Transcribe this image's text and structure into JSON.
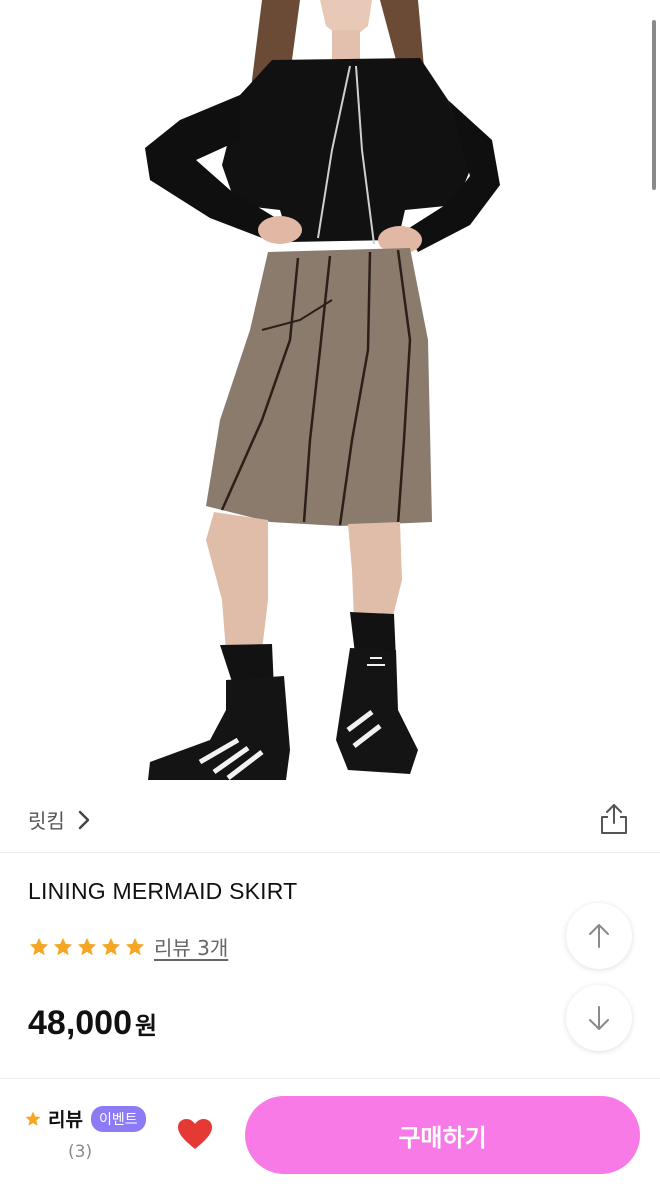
{
  "brand": {
    "name": "릿킴"
  },
  "product": {
    "title": "LINING MERMAID SKIRT",
    "rating": 5,
    "review_link": "리뷰 3개",
    "price": "48,000",
    "price_unit": "원"
  },
  "bottom_bar": {
    "review_title": "리뷰",
    "event_badge": "이벤트",
    "review_count": "(3)",
    "buy_label": "구매하기"
  },
  "colors": {
    "accent": "#f77ae6",
    "badge": "#8b7cf6",
    "star": "#f5a623",
    "heart": "#e53935"
  },
  "icons": [
    "chevron-right-icon",
    "share-icon",
    "star-icon",
    "arrow-up-icon",
    "arrow-down-icon",
    "heart-icon"
  ]
}
